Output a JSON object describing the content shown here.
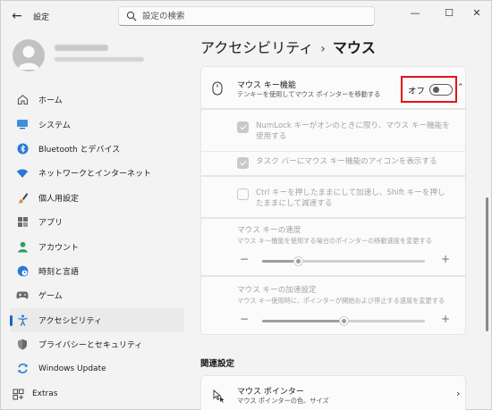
{
  "window": {
    "app_title": "設定",
    "search_placeholder": "設定の検索",
    "minimize": "—",
    "maximize": "☐",
    "close": "✕"
  },
  "sidebar": {
    "items": [
      {
        "label": "ホーム",
        "icon": "home-icon"
      },
      {
        "label": "システム",
        "icon": "system-monitor-icon"
      },
      {
        "label": "Bluetooth とデバイス",
        "icon": "bluetooth-icon"
      },
      {
        "label": "ネットワークとインターネット",
        "icon": "wifi-icon"
      },
      {
        "label": "個人用設定",
        "icon": "brush-icon"
      },
      {
        "label": "アプリ",
        "icon": "apps-icon"
      },
      {
        "label": "アカウント",
        "icon": "person-icon"
      },
      {
        "label": "時刻と言語",
        "icon": "globe-clock-icon"
      },
      {
        "label": "ゲーム",
        "icon": "gamepad-icon"
      },
      {
        "label": "アクセシビリティ",
        "icon": "accessibility-icon",
        "active": true
      },
      {
        "label": "プライバシーとセキュリティ",
        "icon": "shield-icon"
      },
      {
        "label": "Windows Update",
        "icon": "update-icon"
      }
    ],
    "extras_label": "Extras"
  },
  "breadcrumb": {
    "parent": "アクセシビリティ",
    "separator": "›",
    "current": "マウス"
  },
  "mouse_keys": {
    "title": "マウス キー機能",
    "description": "テンキーを使用してマウス ポインターを移動する",
    "toggle_label": "オフ",
    "toggle_on": false,
    "options": [
      {
        "label": "NumLock キーがオンのときに限り、マウス キー機能を使用する",
        "checked": true
      },
      {
        "label": "タスク バーにマウス キー機能のアイコンを表示する",
        "checked": true
      },
      {
        "label": "Ctrl キーを押したままにして加速し、Shift キーを押したままにして減速する",
        "checked": false
      }
    ],
    "speed": {
      "title": "マウス キーの速度",
      "description": "マウス キー機能を使用する場合のポインターの移動速度を変更する",
      "value": 0.22
    },
    "acceleration": {
      "title": "マウス キーの加速設定",
      "description": "マウス キー使用時に、ポインターが開始および停止する速度を変更する",
      "value": 0.5
    },
    "minus": "−",
    "plus": "+"
  },
  "related": {
    "section_title": "関連設定",
    "mouse_pointer_title": "マウス ポインター",
    "mouse_pointer_desc": "マウス ポインターの色、サイズ"
  },
  "colors": {
    "accent": "#1466c2",
    "highlight": "#e0141e"
  }
}
